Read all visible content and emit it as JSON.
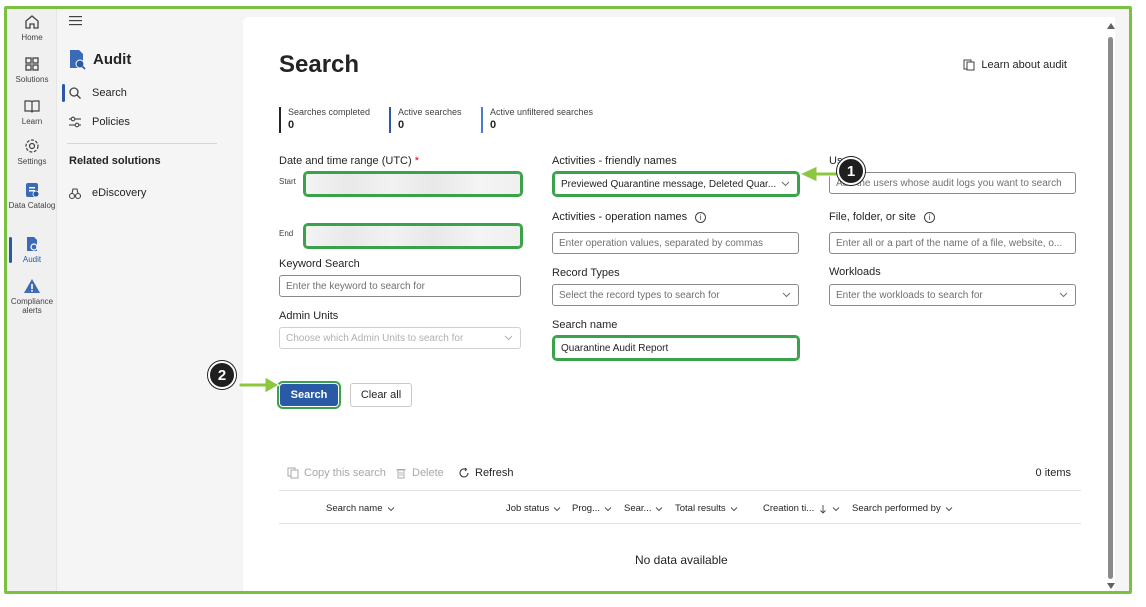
{
  "rail": {
    "items": [
      {
        "label": "Home",
        "icon": "home-icon"
      },
      {
        "label": "Solutions",
        "icon": "solutions-icon"
      },
      {
        "label": "Learn",
        "icon": "learn-icon"
      },
      {
        "label": "Settings",
        "icon": "settings-icon"
      },
      {
        "label": "Data Catalog",
        "icon": "data-catalog-icon"
      },
      {
        "label": "Audit",
        "icon": "audit-icon"
      },
      {
        "label": "Compliance alerts",
        "icon": "compliance-alerts-icon"
      }
    ]
  },
  "nav": {
    "title": "Audit",
    "items": [
      {
        "label": "Search",
        "icon": "search-icon"
      },
      {
        "label": "Policies",
        "icon": "policies-icon"
      }
    ],
    "related_heading": "Related solutions",
    "related_items": [
      {
        "label": "eDiscovery",
        "icon": "ediscovery-icon"
      }
    ]
  },
  "page": {
    "title": "Search",
    "learn_link": "Learn about audit"
  },
  "stats": [
    {
      "label": "Searches completed",
      "value": "0"
    },
    {
      "label": "Active searches",
      "value": "0"
    },
    {
      "label": "Active unfiltered searches",
      "value": "0"
    }
  ],
  "form": {
    "date_label": "Date and time range (UTC)",
    "date_required": "*",
    "start_label": "Start",
    "end_label": "End",
    "keyword_label": "Keyword Search",
    "keyword_placeholder": "Enter the keyword to search for",
    "admin_units_label": "Admin Units",
    "admin_units_placeholder": "Choose which Admin Units to search for",
    "activities_friendly_label": "Activities - friendly names",
    "activities_friendly_value": "Previewed Quarantine message, Deleted Quar...",
    "activities_operation_label": "Activities - operation names",
    "activities_operation_placeholder": "Enter operation values, separated by commas",
    "record_types_label": "Record Types",
    "record_types_placeholder": "Select the record types to search for",
    "search_name_label": "Search name",
    "search_name_value": "Quarantine Audit Report",
    "users_label": "Users",
    "users_placeholder": "Add the users whose audit logs you want to search",
    "file_label": "File, folder, or site",
    "file_placeholder": "Enter all or a part of the name of a file, website, o...",
    "workloads_label": "Workloads",
    "workloads_placeholder": "Enter the workloads to search for",
    "search_button": "Search",
    "clear_button": "Clear all"
  },
  "toolbar": {
    "copy": "Copy this search",
    "delete": "Delete",
    "refresh": "Refresh",
    "items_count": "0 items"
  },
  "table": {
    "columns": [
      "Search name",
      "Job status",
      "Prog...",
      "Sear...",
      "Total results",
      "Creation ti...",
      "Search performed by"
    ],
    "empty_message": "No data available"
  },
  "callouts": [
    "1",
    "2"
  ],
  "colors": {
    "accent": "#2a5aa6",
    "highlight": "#3aa24a",
    "arrow": "#8dc63f",
    "frame": "#7ac142"
  }
}
